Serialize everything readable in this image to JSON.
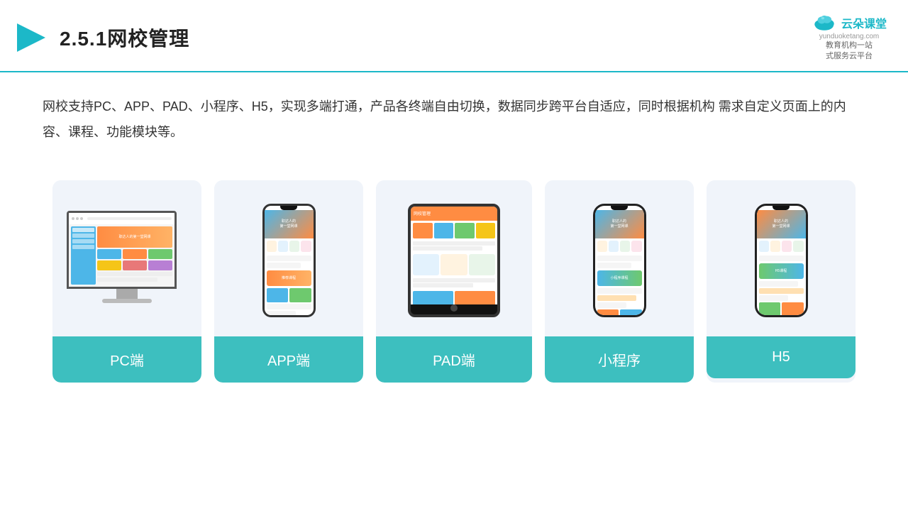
{
  "header": {
    "title": "2.5.1网校管理",
    "logo": {
      "name": "云朵课堂",
      "domain": "yunduoketang.com",
      "tagline": "教育机构一站\n式服务云平台"
    }
  },
  "description": "网校支持PC、APP、PAD、小程序、H5，实现多端打通，产品各终端自由切换，数据同步跨平台自适应，同时根据机构\n需求自定义页面上的内容、课程、功能模块等。",
  "cards": [
    {
      "label": "PC端",
      "type": "pc"
    },
    {
      "label": "APP端",
      "type": "phone"
    },
    {
      "label": "PAD端",
      "type": "tablet"
    },
    {
      "label": "小程序",
      "type": "phone2"
    },
    {
      "label": "H5",
      "type": "phone3"
    }
  ],
  "accent_color": "#3dbfbf",
  "title_color": "#222"
}
